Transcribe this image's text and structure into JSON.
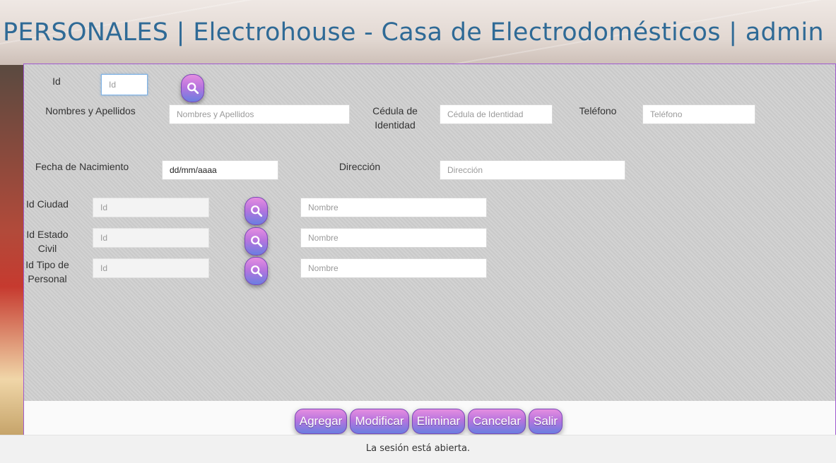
{
  "header": {
    "title": "PERSONALES | Electrohouse - Casa de Electrodomésticos | admin"
  },
  "form": {
    "id": {
      "label": "Id",
      "placeholder": "Id",
      "value": ""
    },
    "nombres": {
      "label": "Nombres y Apellidos",
      "placeholder": "Nombres y Apellidos",
      "value": ""
    },
    "cedula": {
      "label": "Cédula de Identidad",
      "placeholder": "Cédula de Identidad",
      "value": ""
    },
    "telefono": {
      "label": "Teléfono",
      "placeholder": "Teléfono",
      "value": ""
    },
    "fecha_nacimiento": {
      "label": "Fecha de Nacimiento",
      "value": "dd/mm/aaaa"
    },
    "direccion": {
      "label": "Dirección",
      "placeholder": "Dirección",
      "value": ""
    },
    "ciudad": {
      "label": "Id Ciudad",
      "id_placeholder": "Id",
      "name_placeholder": "Nombre"
    },
    "estado_civil": {
      "label": "Id Estado Civil",
      "id_placeholder": "Id",
      "name_placeholder": "Nombre"
    },
    "tipo_personal": {
      "label": "Id Tipo de Personal",
      "id_placeholder": "Id",
      "name_placeholder": "Nombre"
    }
  },
  "actions": {
    "agregar": "Agregar",
    "modificar": "Modificar",
    "eliminar": "Eliminar",
    "cancelar": "Cancelar",
    "salir": "Salir"
  },
  "status": {
    "text": "La sesión está abierta."
  },
  "icons": {
    "search": "search-icon"
  },
  "colors": {
    "title": "#2f6a96",
    "button_top": "#e58ee0",
    "button_bottom": "#6a7ee0",
    "panel": "#cfcfcf",
    "panel_border": "#a05ad0"
  }
}
